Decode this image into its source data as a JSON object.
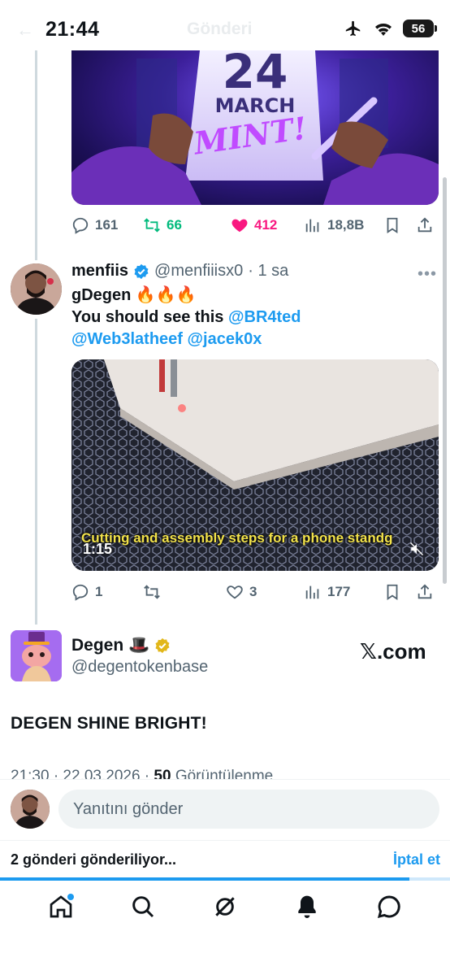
{
  "status": {
    "time": "21:44",
    "ghost_title": "Gönderi",
    "battery": "56",
    "icons": [
      "airplane-icon",
      "wifi-icon",
      "battery-icon"
    ]
  },
  "tweet1": {
    "image_text_1": "24",
    "image_text_2": "MARCH",
    "image_text_3": "MINT!",
    "replies": "161",
    "retweets": "66",
    "likes": "412",
    "views": "18,8B"
  },
  "tweet2": {
    "name": "menfiis",
    "handle": "@menfiiisx0",
    "time": "· 1 sa",
    "line1_text": "gDegen ",
    "line1_emoji": "🔥🔥🔥",
    "line2_text": " You should see this ",
    "mention1": "@BR4ted",
    "mention2": "@Web3latheef",
    "mention3": "@jacek0x",
    "video_caption": "Cutting and assembly steps for a phone standg",
    "video_time": "1:15",
    "replies": "1",
    "likes": "3",
    "views": "177"
  },
  "quote": {
    "name": "Degen",
    "hat_emoji": "🎩",
    "handle": "@degentokenbase",
    "source": "𝕏.com",
    "text": "DEGEN SHINE BRIGHT!",
    "meta_time": "21:30 · 22.03.2026 · ",
    "meta_views_count": "50",
    "meta_views_label": " Görüntülenme"
  },
  "reply_bar": {
    "placeholder": "Yanıtını gönder"
  },
  "sending": {
    "text": "2 gönderi gönderiliyor...",
    "cancel": "İptal et",
    "progress": 0.91
  },
  "nav": {
    "items": [
      "home-icon",
      "search-icon",
      "grok-icon",
      "notifications-icon",
      "messages-icon"
    ]
  },
  "colors": {
    "accent": "#1d9bf0",
    "retweet_green": "#00ba7c",
    "like_pink": "#f91880",
    "muted": "#536471"
  }
}
